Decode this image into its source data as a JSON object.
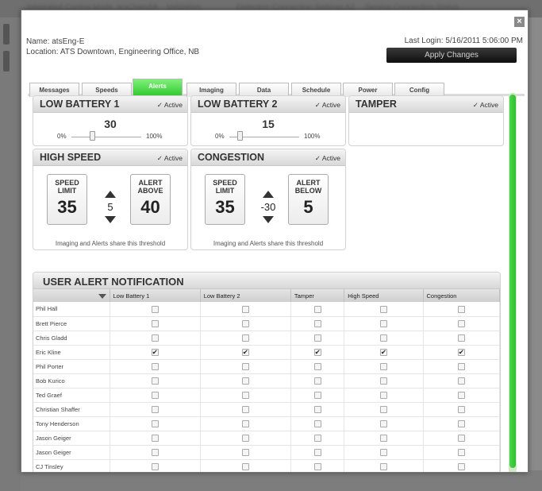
{
  "background_bar": {
    "items": [
      "Integrated Control Mode",
      "lesChandiA",
      "Validation",
      "Detection Connection Settings A2",
      "Service Connection Status"
    ]
  },
  "dialog": {
    "close_glyph": "×",
    "name_line": "Name:  atsEng-E",
    "location_line": "Location:  ATS Downtown, Engineering Office, NB",
    "last_login": "Last Login: 5/16/2011 5:06:00 PM",
    "apply_label": "Apply Changes"
  },
  "tabs": [
    {
      "label": "Messages"
    },
    {
      "label": "Speeds"
    },
    {
      "label": "Alerts",
      "active": true
    },
    {
      "label": "Imaging"
    },
    {
      "label": "Data"
    },
    {
      "label": "Schedule"
    },
    {
      "label": "Power"
    },
    {
      "label": "Config"
    }
  ],
  "active_label": "Active",
  "low_battery_1": {
    "title": "LOW BATTERY 1",
    "value": "30",
    "min": "0%",
    "max": "100%",
    "level_pct": 30,
    "active": true
  },
  "low_battery_2": {
    "title": "LOW BATTERY 2",
    "value": "15",
    "min": "0%",
    "max": "100%",
    "level_pct": 15,
    "active": true
  },
  "tamper": {
    "title": "TAMPER",
    "active": true
  },
  "high_speed": {
    "title": "HIGH SPEED",
    "speed_limit_label_1": "SPEED",
    "speed_limit_label_2": "LIMIT",
    "speed_limit": "35",
    "offset": "5",
    "alert_label_1": "ALERT",
    "alert_label_2": "ABOVE",
    "alert_value": "40",
    "note": "Imaging and Alerts share this threshold",
    "active": true
  },
  "congestion": {
    "title": "CONGESTION",
    "speed_limit_label_1": "SPEED",
    "speed_limit_label_2": "LIMIT",
    "speed_limit": "35",
    "offset": "-30",
    "alert_label_1": "ALERT",
    "alert_label_2": "BELOW",
    "alert_value": "5",
    "note": "Imaging and Alerts share this threshold",
    "active": true
  },
  "user_alert_notification": {
    "title": "USER ALERT NOTIFICATION",
    "columns": [
      "Low Battery 1",
      "Low Battery 2",
      "Tamper",
      "High Speed",
      "Congestion"
    ],
    "rows": [
      {
        "name": "Phil Hall",
        "checks": [
          false,
          false,
          false,
          false,
          false
        ]
      },
      {
        "name": "Brett Pierce",
        "checks": [
          false,
          false,
          false,
          false,
          false
        ]
      },
      {
        "name": "Chris Gladd",
        "checks": [
          false,
          false,
          false,
          false,
          false
        ]
      },
      {
        "name": "Eric Kline",
        "checks": [
          true,
          true,
          true,
          true,
          true
        ]
      },
      {
        "name": "Phil Porter",
        "checks": [
          false,
          false,
          false,
          false,
          false
        ]
      },
      {
        "name": "Bob Kurico",
        "checks": [
          false,
          false,
          false,
          false,
          false
        ]
      },
      {
        "name": "Ted Graef",
        "checks": [
          false,
          false,
          false,
          false,
          false
        ]
      },
      {
        "name": "Christian Shaffer",
        "checks": [
          false,
          false,
          false,
          false,
          false
        ]
      },
      {
        "name": "Tony Henderson",
        "checks": [
          false,
          false,
          false,
          false,
          false
        ]
      },
      {
        "name": "Jason Geiger",
        "checks": [
          false,
          false,
          false,
          false,
          false
        ]
      },
      {
        "name": "Jason Geiger",
        "checks": [
          false,
          false,
          false,
          false,
          false
        ]
      },
      {
        "name": "CJ Tinsley",
        "checks": [
          false,
          false,
          false,
          false,
          false
        ]
      }
    ]
  },
  "colors": {
    "accent": "#2dc52a",
    "scrollbar": "#3fcc3f"
  }
}
